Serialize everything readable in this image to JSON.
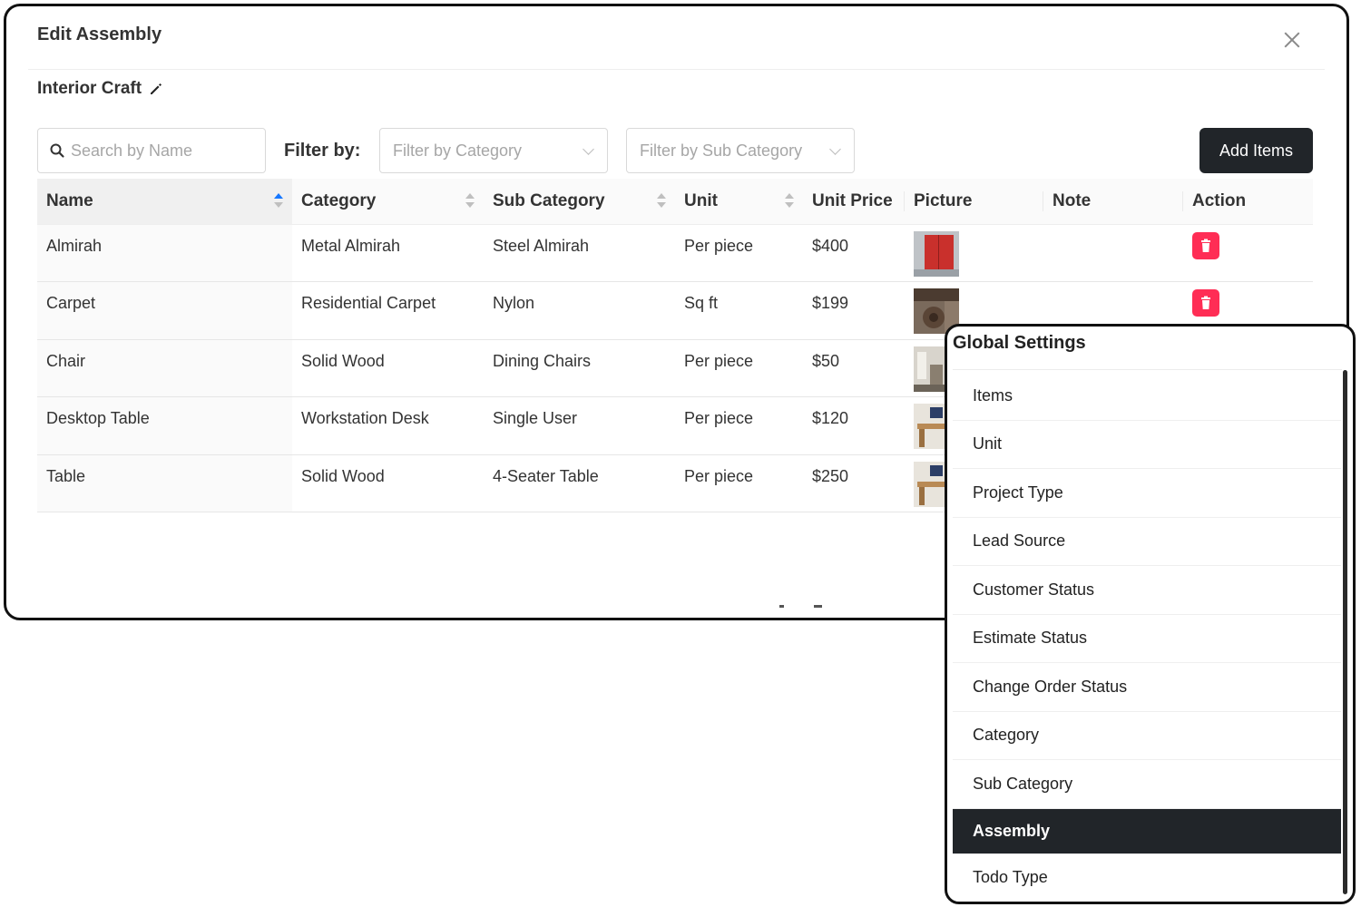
{
  "modal": {
    "title": "Edit Assembly",
    "project_name": "Interior Craft",
    "search": {
      "placeholder": "Search by Name",
      "value": ""
    },
    "filter_label": "Filter by:",
    "category_filter": {
      "placeholder": "Filter by Category"
    },
    "subcategory_filter": {
      "placeholder": "Filter by Sub Category"
    },
    "add_button_label": "Add Items"
  },
  "table": {
    "columns": [
      "Name",
      "Category",
      "Sub Category",
      "Unit",
      "Unit Price",
      "Picture",
      "Note",
      "Action"
    ],
    "rows": [
      {
        "name": "Almirah",
        "category": "Metal Almirah",
        "sub_category": "Steel Almirah",
        "unit": "Per piece",
        "unit_price": "$400",
        "note": ""
      },
      {
        "name": "Carpet",
        "category": "Residential Carpet",
        "sub_category": "Nylon",
        "unit": "Sq ft",
        "unit_price": "$199",
        "note": ""
      },
      {
        "name": "Chair",
        "category": "Solid Wood",
        "sub_category": "Dining Chairs",
        "unit": "Per piece",
        "unit_price": "$50",
        "note": ""
      },
      {
        "name": "Desktop Table",
        "category": "Workstation Desk",
        "sub_category": "Single User",
        "unit": "Per piece",
        "unit_price": "$120",
        "note": ""
      },
      {
        "name": "Table",
        "category": "Solid Wood",
        "sub_category": "4-Seater Table",
        "unit": "Per piece",
        "unit_price": "$250",
        "note": ""
      }
    ]
  },
  "global_settings": {
    "title": "Global Settings",
    "items": [
      "Items",
      "Unit",
      "Project Type",
      "Lead Source",
      "Customer Status",
      "Estimate Status",
      "Change Order Status",
      "Category",
      "Sub Category",
      "Assembly",
      "Todo Type"
    ],
    "active_item": "Assembly"
  },
  "colors": {
    "primary_dark": "#212529",
    "delete_red": "#ff2d55",
    "sort_active": "#1677ff"
  }
}
